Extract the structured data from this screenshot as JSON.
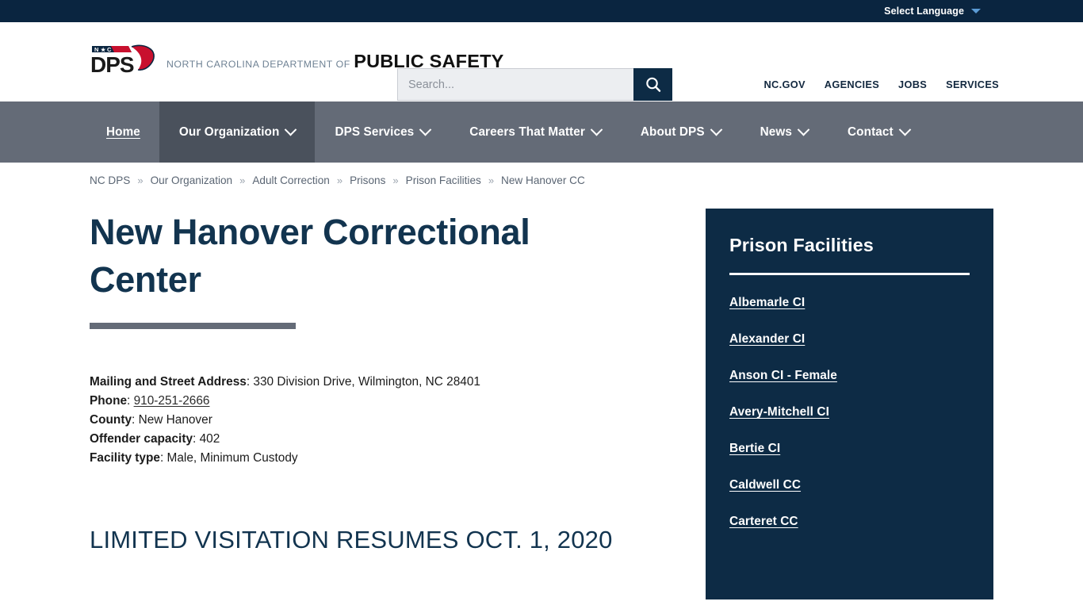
{
  "topbar": {
    "language_label": "Select Language",
    "caret_icon": "chevron-down-icon"
  },
  "header": {
    "logo": {
      "badge": "N C",
      "acronym": "DPS",
      "line1": "NORTH CAROLINA DEPARTMENT OF",
      "line2": "PUBLIC SAFETY"
    },
    "search": {
      "placeholder": "Search...",
      "value": "",
      "button_icon": "search-icon"
    },
    "util_links": [
      "NC.GOV",
      "AGENCIES",
      "JOBS",
      "SERVICES"
    ]
  },
  "nav": {
    "items": [
      {
        "label": "Home",
        "has_caret": false,
        "active": false,
        "underline": true
      },
      {
        "label": "Our Organization",
        "has_caret": true,
        "active": true,
        "underline": false
      },
      {
        "label": "DPS Services",
        "has_caret": true,
        "active": false,
        "underline": false
      },
      {
        "label": "Careers That Matter",
        "has_caret": true,
        "active": false,
        "underline": false
      },
      {
        "label": "About DPS",
        "has_caret": true,
        "active": false,
        "underline": false
      },
      {
        "label": "News",
        "has_caret": true,
        "active": false,
        "underline": false
      },
      {
        "label": "Contact",
        "has_caret": true,
        "active": false,
        "underline": false
      }
    ]
  },
  "breadcrumb": {
    "separator": "»",
    "items": [
      "NC DPS",
      "Our Organization",
      "Adult Correction",
      "Prisons",
      "Prison Facilities"
    ],
    "current": "New Hanover CC"
  },
  "main": {
    "title": "New Hanover Correctional Center",
    "details": [
      {
        "label": "Mailing and Street Address",
        "value": "330 Division Drive, Wilmington, NC 28401",
        "link": false
      },
      {
        "label": "Phone",
        "value": "910-251-2666",
        "link": true
      },
      {
        "label": "County",
        "value": "New Hanover",
        "link": false
      },
      {
        "label": "Offender capacity",
        "value": "402",
        "link": false
      },
      {
        "label": "Facility type",
        "value": "Male, Minimum Custody",
        "link": false
      }
    ],
    "subheading": "LIMITED VISITATION RESUMES OCT. 1, 2020"
  },
  "sidebar": {
    "title": "Prison Facilities",
    "links": [
      "Albemarle CI",
      "Alexander CI",
      "Anson CI - Female",
      "Avery-Mitchell CI",
      "Bertie CI",
      "Caldwell CC",
      "Carteret CC"
    ]
  },
  "colors": {
    "navy": "#0a2540",
    "panel_navy": "#0d2b45",
    "nav_gray": "#646b77",
    "nav_active_gray": "#4a515c",
    "title_navy": "#12344f",
    "breadcrumb_gray": "#5a6573",
    "search_bg": "#eceef1",
    "caret_blue": "#5b9bd5"
  }
}
